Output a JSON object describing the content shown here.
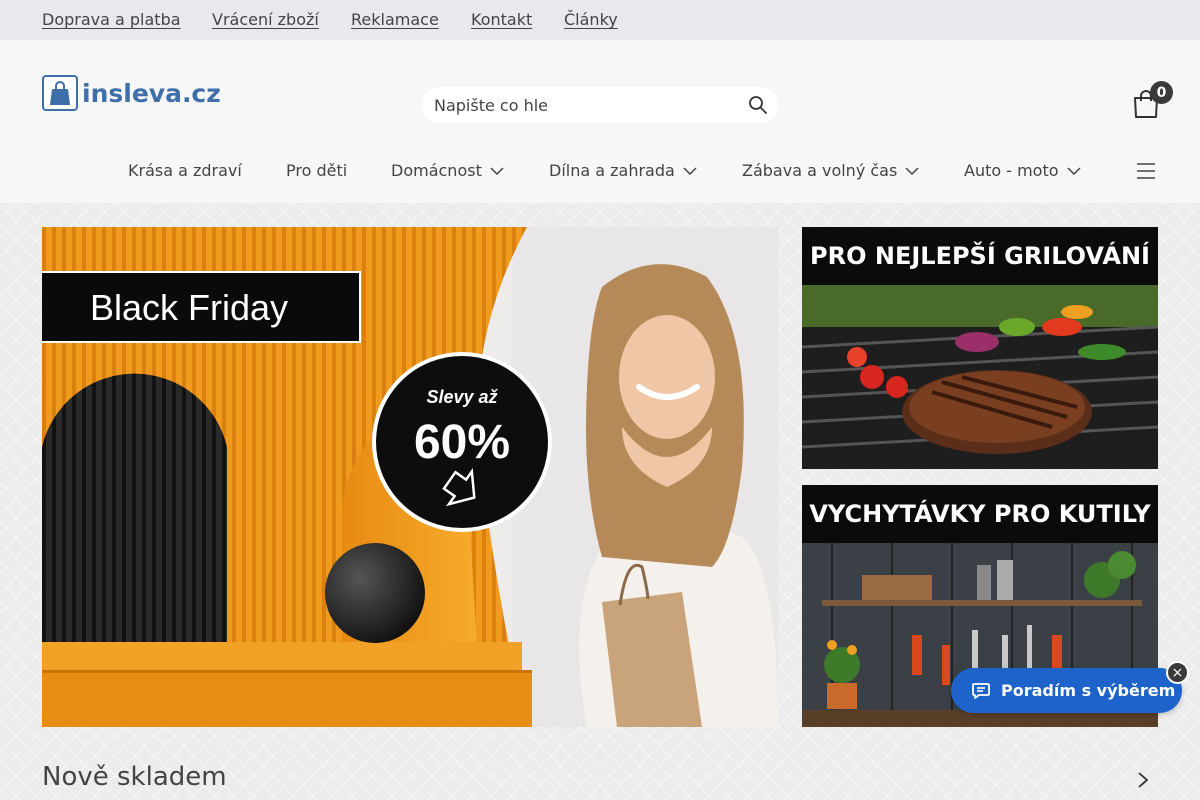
{
  "topbar": {
    "links": [
      {
        "label": "Doprava a platba"
      },
      {
        "label": "Vrácení zboží"
      },
      {
        "label": "Reklamace"
      },
      {
        "label": "Kontakt"
      },
      {
        "label": "Články"
      }
    ]
  },
  "header": {
    "brand": "insleva.cz",
    "search_placeholder": "Napište co hle",
    "cart_count": "0"
  },
  "nav": {
    "items": [
      {
        "label": "Krása a zdraví"
      },
      {
        "label": "Pro děti"
      },
      {
        "label": "Domácnost"
      },
      {
        "label": "Dílna a zahrada"
      },
      {
        "label": "Zábava a volný čas"
      },
      {
        "label": "Auto - moto"
      }
    ]
  },
  "hero": {
    "headline": "Black Friday",
    "badge_top": "Slevy až",
    "badge_value": "60%"
  },
  "side_banners": [
    {
      "title": "PRO NEJLEPŠÍ GRILOVÁNÍ"
    },
    {
      "title": "VYCHYTÁVKY PRO KUTILY"
    }
  ],
  "chat": {
    "label": "Poradím s výběrem",
    "close": "×"
  },
  "section": {
    "title": "Nově skladem"
  },
  "colors": {
    "brand": "#3f6fa8",
    "chat": "#1e63c9",
    "hero_orange": "#f0a020"
  }
}
